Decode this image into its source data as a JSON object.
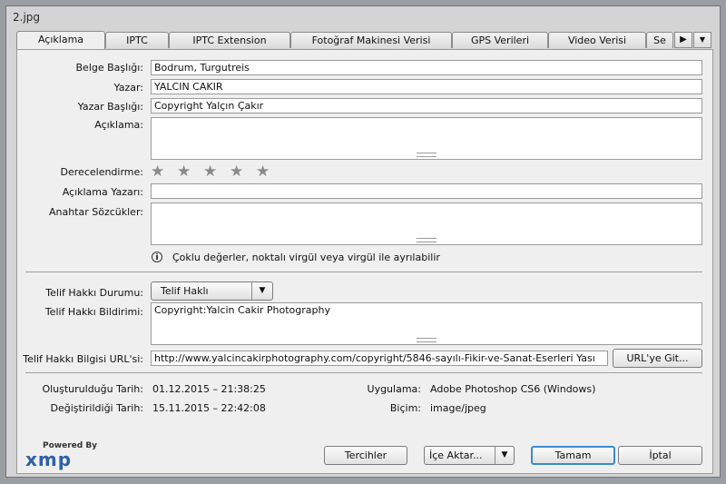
{
  "window": {
    "title": "2.jpg"
  },
  "tabs": [
    {
      "label": "Açıklama"
    },
    {
      "label": "IPTC"
    },
    {
      "label": "IPTC Extension"
    },
    {
      "label": "Fotoğraf Makinesi Verisi"
    },
    {
      "label": "GPS Verileri"
    },
    {
      "label": "Video Verisi"
    },
    {
      "label": "Se"
    }
  ],
  "tab_nav": {
    "next": "▶",
    "menu": "▼"
  },
  "form": {
    "belge_basligi": {
      "label": "Belge Başlığı:",
      "value": "Bodrum, Turgutreis"
    },
    "yazar": {
      "label": "Yazar:",
      "value": "YALCIN CAKIR"
    },
    "yazar_basligi": {
      "label": "Yazar Başlığı:",
      "value": "Copyright Yalçın Çakır"
    },
    "aciklama": {
      "label": "Açıklama:",
      "value": ""
    },
    "derecelendirme": {
      "label": "Derecelendirme:",
      "rating": 0,
      "max": 5,
      "star_glyph": "★"
    },
    "aciklama_yazari": {
      "label": "Açıklama Yazarı:",
      "value": ""
    },
    "anahtar_sozcukler": {
      "label": "Anahtar Sözcükler:",
      "value": ""
    },
    "hint": "Çoklu değerler, noktalı virgül veya virgül ile ayrılabilir",
    "hint_icon": "i"
  },
  "copyright": {
    "durum": {
      "label": "Telif Hakkı Durumu:",
      "value": "Telif Haklı",
      "arrow": "▼"
    },
    "bildirim": {
      "label": "Telif Hakkı Bildirimi:",
      "value": "Copyright:Yalcin Cakir Photography"
    },
    "url": {
      "label": "Telif Hakkı Bilgisi URL'si:",
      "value": "http://www.yalcincakirphotography.com/copyright/5846-sayılı-Fikir-ve-Sanat-Eserleri Yası",
      "button": "URL'ye Git..."
    }
  },
  "meta": {
    "olusturuldugu": {
      "label": "Oluşturulduğu Tarih:",
      "value": "01.12.2015 – 21:38:25"
    },
    "degistirildigi": {
      "label": "Değiştirildiği Tarih:",
      "value": "15.11.2015 – 22:42:08"
    },
    "uygulama": {
      "label": "Uygulama:",
      "value": "Adobe Photoshop CS6 (Windows)"
    },
    "bicim": {
      "label": "Biçim:",
      "value": "image/jpeg"
    }
  },
  "footer": {
    "powered_by": "Powered By",
    "logo": "xmp",
    "tercihler": "Tercihler",
    "ice_aktar": "İçe Aktar...",
    "ice_aktar_arrow": "▼",
    "tamam": "Tamam",
    "iptal": "İptal"
  },
  "colors": {
    "primary_border": "#3b8bd1",
    "logo_blue": "#2d5fa8"
  }
}
